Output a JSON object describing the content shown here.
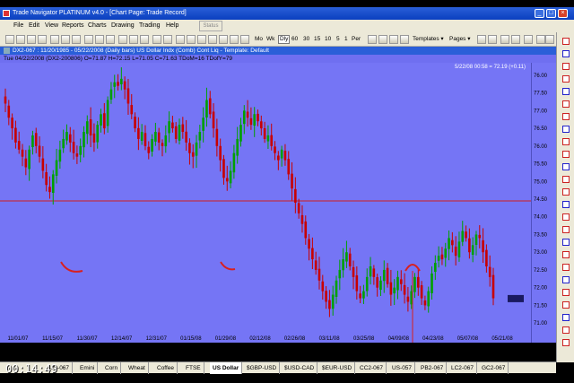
{
  "window": {
    "title": "Trade Navigator PLATINUM v4.0  -  [Chart Page: Trade Record]",
    "buttons": [
      "_",
      "□",
      "×"
    ]
  },
  "menu": {
    "items": [
      "File",
      "Edit",
      "View",
      "Reports",
      "Charts",
      "Drawing",
      "Trading",
      "Help"
    ],
    "status_label": "Status"
  },
  "toolbar": {
    "zoom_label": "Mo",
    "wk_label": "Wk",
    "periods": [
      "Dly",
      "60",
      "30",
      "15",
      "10",
      "5",
      "1",
      "Per"
    ],
    "selected_period": "Dly",
    "templates_label": "Templates ▾",
    "pages_label": "Pages ▾"
  },
  "chart_header": {
    "title": "DX2-067 : 11/20/1985 - 05/22/2008 (Daily bars)   US Dollar Indx (Comb) Cont Liq   - Template: Default"
  },
  "info_line": {
    "text": "Tue  04/22/2008 (DX2-200806)  O=71.87  H=72.15  L=71.05  C=71.63  TDoM=16  TDofY=79"
  },
  "chart_data": {
    "type": "candlestick",
    "corner_label": "5/22/08 00:58 = 72.19 (+0.11)",
    "y_ticks": [
      "76.00",
      "77.50",
      "77.00",
      "76.50",
      "76.00",
      "75.50",
      "75.00",
      "74.50",
      "74.00",
      "73.50",
      "73.00",
      "72.50",
      "72.00",
      "71.50",
      "71.00"
    ],
    "y_tick_values": [
      78.0,
      77.5,
      77.0,
      76.5,
      76.0,
      75.5,
      75.0,
      74.5,
      74.0,
      73.5,
      73.0,
      72.5,
      72.0,
      71.5,
      71.0
    ],
    "ylim": [
      70.75,
      78.2
    ],
    "x_ticks": [
      "11/01/07",
      "11/15/07",
      "11/30/07",
      "12/14/07",
      "12/31/07",
      "01/15/08",
      "01/29/08",
      "02/12/08",
      "02/26/08",
      "03/11/08",
      "03/25/08",
      "04/09/08",
      "04/23/08",
      "05/07/08",
      "05/21/08"
    ],
    "horizontal_line": 74.45,
    "last_price": 71.69,
    "closes": [
      77.2,
      76.8,
      76.5,
      76.1,
      75.9,
      75.7,
      75.4,
      75.9,
      76.3,
      76.0,
      75.7,
      75.3,
      74.9,
      74.7,
      75.2,
      75.6,
      75.9,
      76.2,
      76.4,
      76.1,
      75.8,
      75.7,
      76.0,
      76.4,
      76.7,
      76.3,
      76.1,
      76.6,
      76.9,
      76.5,
      77.3,
      77.6,
      77.8,
      77.7,
      77.9,
      77.6,
      77.2,
      76.9,
      76.5,
      76.2,
      76.4,
      76.0,
      75.8,
      76.2,
      76.4,
      76.1,
      76.0,
      76.3,
      76.7,
      76.5,
      76.2,
      76.6,
      76.4,
      76.1,
      75.8,
      75.7,
      76.1,
      76.4,
      76.8,
      77.3,
      76.9,
      76.5,
      76.0,
      75.6,
      75.1,
      75.0,
      75.3,
      75.8,
      76.2,
      76.6,
      77.0,
      76.8,
      76.6,
      76.9,
      76.7,
      76.5,
      76.2,
      76.3,
      76.0,
      75.8,
      75.6,
      75.9,
      75.6,
      75.2,
      74.8,
      74.4,
      74.1,
      73.8,
      73.4,
      73.1,
      72.8,
      72.5,
      72.2,
      71.9,
      71.6,
      71.4,
      71.8,
      72.2,
      72.5,
      72.8,
      73.0,
      72.6,
      72.3,
      71.9,
      71.7,
      71.9,
      72.3,
      72.6,
      72.3,
      72.0,
      72.2,
      72.5,
      72.1,
      71.8,
      72.0,
      72.3,
      72.1,
      71.8,
      71.6,
      71.9,
      72.3,
      72.0,
      71.7,
      71.5,
      71.9,
      72.4,
      72.7,
      72.9,
      72.8,
      73.1,
      73.4,
      73.2,
      72.9,
      73.3,
      73.6,
      73.4,
      73.0,
      73.2,
      73.5,
      73.4,
      73.0,
      72.6,
      72.3,
      71.7
    ]
  },
  "tabs": [
    "US-067",
    "Emini",
    "Corn",
    "Wheat",
    "Coffee",
    "FTSE",
    "US Dollar",
    "$GBP-USD",
    "$USD-CAD",
    "$EUR-USD",
    "CC2-067",
    "US-057",
    "PB2-067",
    "LC2-067",
    "GC2-067"
  ],
  "selected_tab": "US Dollar",
  "video_timestamp": "00:14:49",
  "colors": {
    "chart_bg": "#7575f5",
    "up_bar": "#00a000",
    "down_bar": "#c80000",
    "hline": "#d02020",
    "title_bar": "#0a3fbf"
  }
}
